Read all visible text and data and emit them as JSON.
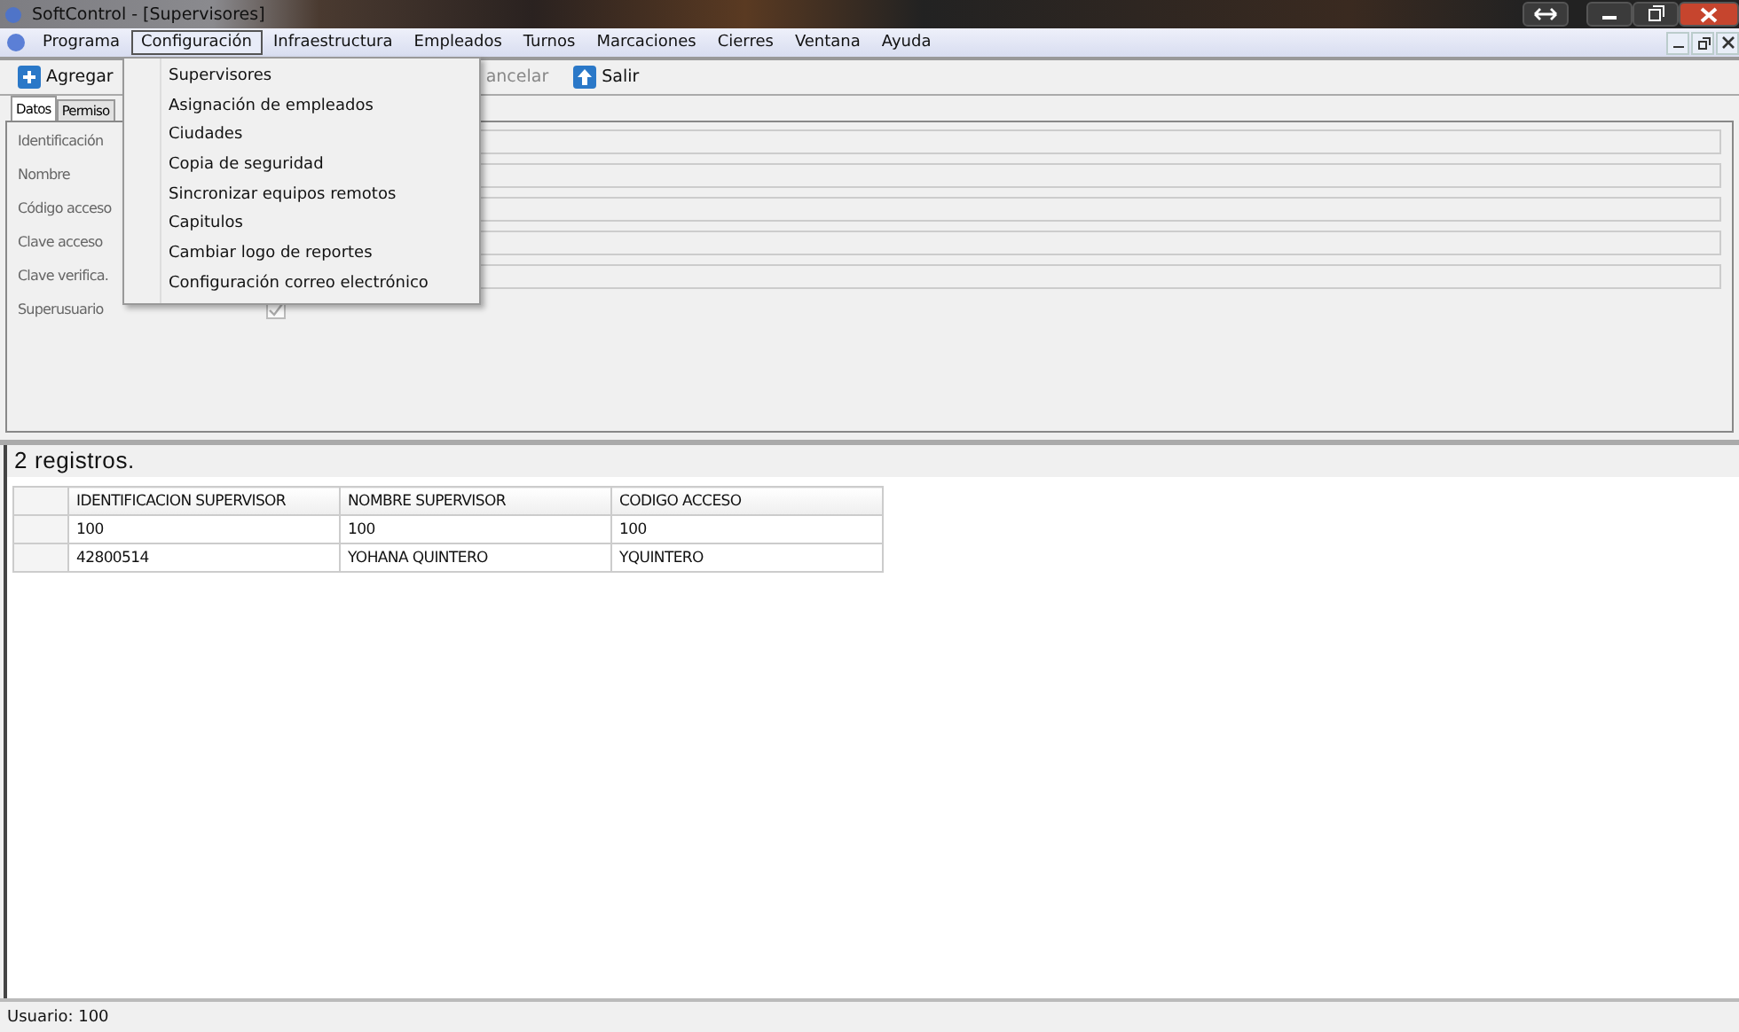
{
  "window": {
    "title": "SoftControl - [Supervisores]"
  },
  "menu": [
    {
      "label": "Programa",
      "selected": false
    },
    {
      "label": "Configuración",
      "selected": true
    },
    {
      "label": "Infraestructura",
      "selected": false
    },
    {
      "label": "Empleados",
      "selected": false
    },
    {
      "label": "Turnos",
      "selected": false
    },
    {
      "label": "Marcaciones",
      "selected": false
    },
    {
      "label": "Cierres",
      "selected": false
    },
    {
      "label": "Ventana",
      "selected": false
    },
    {
      "label": "Ayuda",
      "selected": false
    }
  ],
  "dropdown": [
    "Supervisores",
    "Asignación de empleados",
    "Ciudades",
    "Copia de seguridad",
    "Sincronizar equipos remotos",
    "Capitulos",
    "Cambiar logo de reportes",
    "Configuración correo electrónico"
  ],
  "toolbar": [
    {
      "label": "Agregar",
      "kind": "add",
      "disabled": false
    },
    {
      "label": "ancelar",
      "kind": "none",
      "disabled": true
    },
    {
      "label": "Salir",
      "kind": "exit",
      "disabled": false
    }
  ],
  "tabs": [
    {
      "label": "Datos",
      "selected": true
    },
    {
      "label": "Permiso",
      "selected": false
    }
  ],
  "fields": [
    {
      "label": "Identificación",
      "kind": "text"
    },
    {
      "label": "Nombre",
      "kind": "text"
    },
    {
      "label": "Código acceso",
      "kind": "text"
    },
    {
      "label": "Clave acceso",
      "kind": "text"
    },
    {
      "label": "Clave verifica.",
      "kind": "text"
    },
    {
      "label": "Superusuario",
      "kind": "checkbox",
      "checked": true,
      "disabled": true
    }
  ],
  "records": "2 registros.",
  "table": {
    "columns": [
      "IDENTIFICACION SUPERVISOR",
      "NOMBRE SUPERVISOR",
      "CODIGO ACCESO"
    ],
    "rows": [
      [
        "100",
        "100",
        "100"
      ],
      [
        "42800514",
        "YOHANA QUINTERO",
        "YQUINTERO"
      ]
    ]
  },
  "status_bar": "Usuario: 100"
}
